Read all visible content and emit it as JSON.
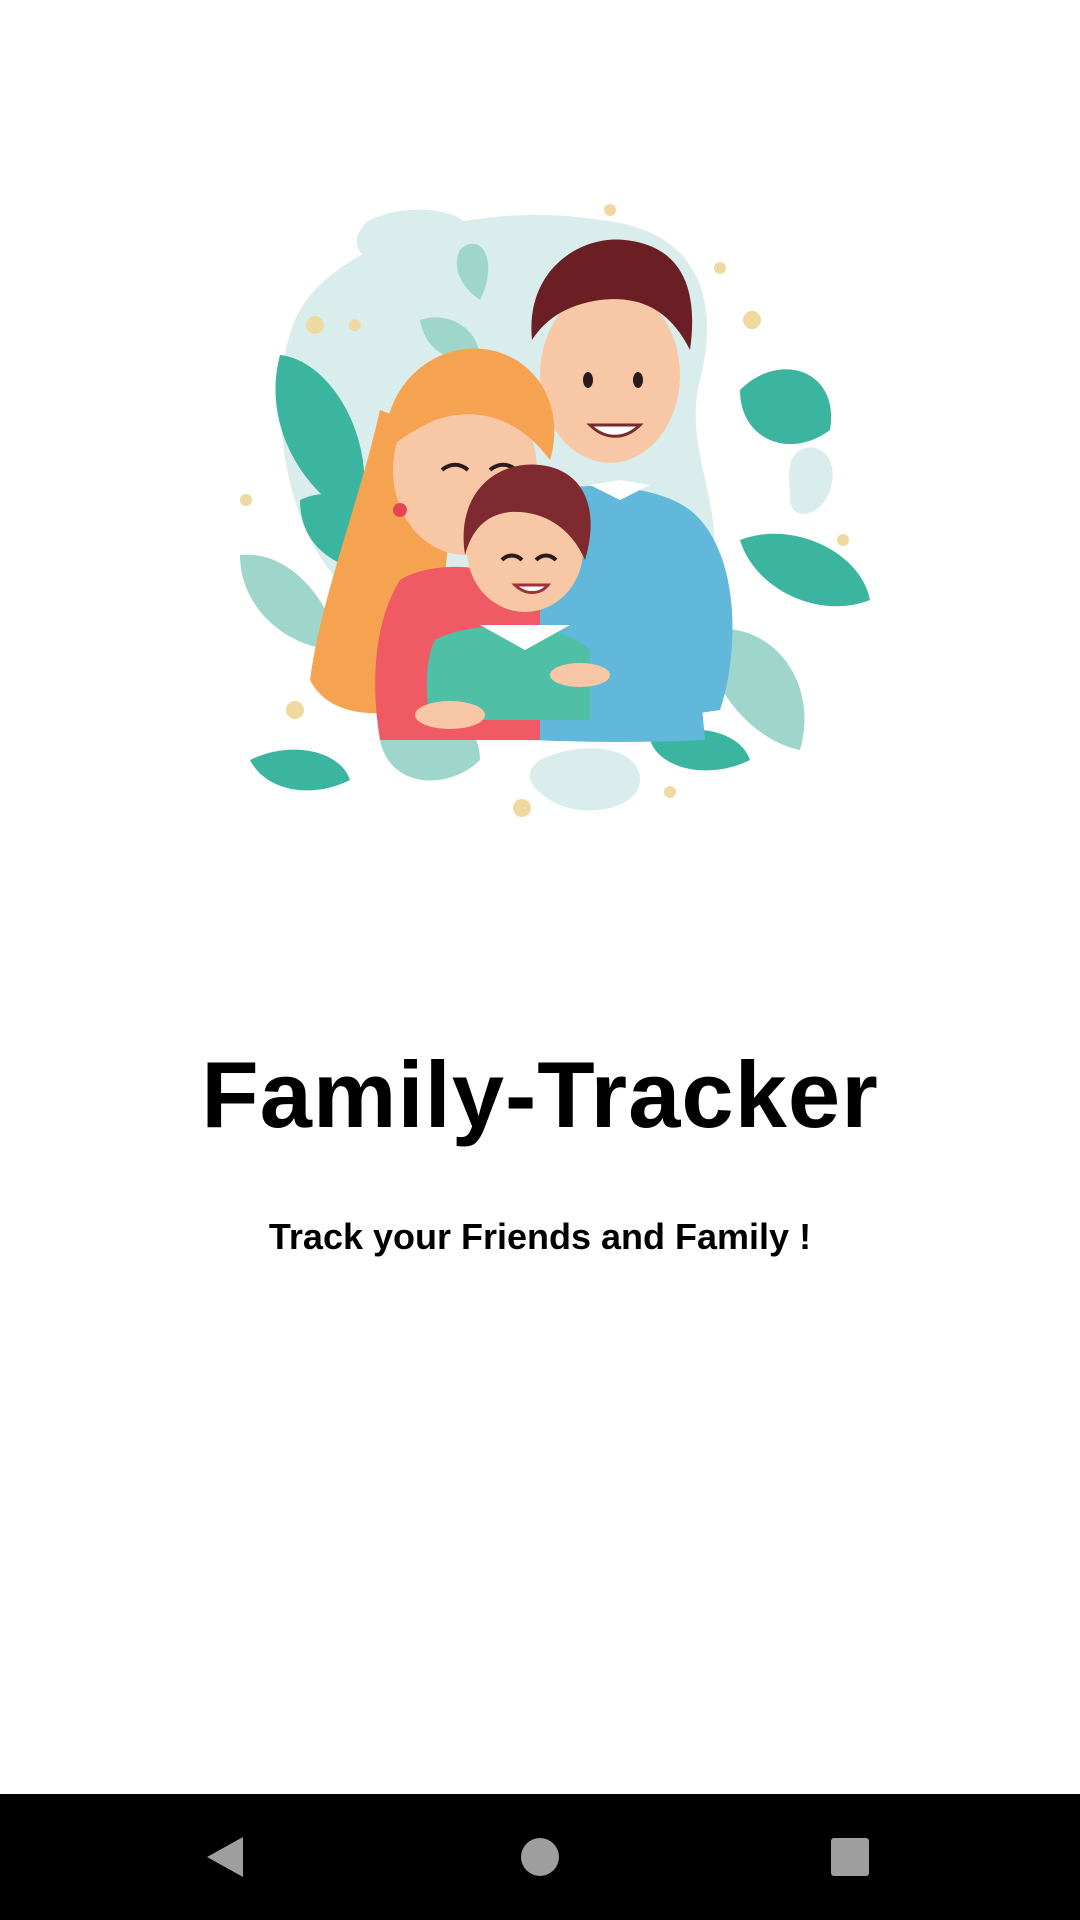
{
  "app": {
    "title": "Family-Tracker",
    "tagline": "Track your Friends and Family !"
  },
  "illustration": {
    "subject": "family-hug-illustration",
    "colors": {
      "leaf_dark": "#3BB59F",
      "leaf_light": "#9FD6CB",
      "blob": "#D9EEEC",
      "dot": "#F0D9A0",
      "mother_hair": "#F6A351",
      "father_hair": "#6B1F24",
      "girl_hair": "#7E2A2E",
      "skin": "#F8C7A6",
      "father_sweater": "#62B8DA",
      "mother_top": "#EF5A64",
      "girl_top": "#4FBFA5"
    }
  },
  "navigation_bar": {
    "back": "back-icon",
    "home": "home-icon",
    "recents": "recents-icon",
    "color": "#9E9E9E"
  }
}
